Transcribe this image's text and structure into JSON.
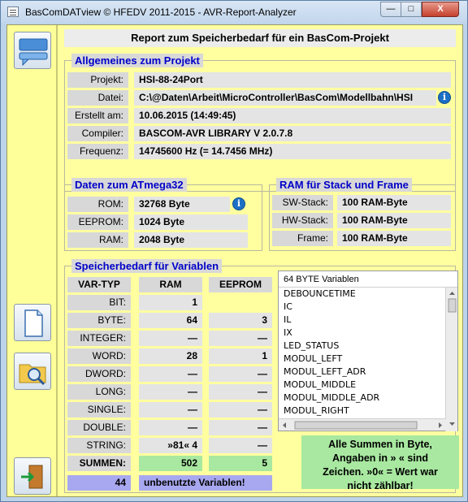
{
  "window": {
    "title": "BasComDATview © HFEDV 2011-2015 - AVR-Report-Analyzer",
    "minimize_glyph": "—",
    "maximize_glyph": "□",
    "close_glyph": "X"
  },
  "report": {
    "title": "Report zum Speicherbedarf für ein BasCom-Projekt"
  },
  "general": {
    "title": "Allgemeines zum Projekt",
    "rows": [
      {
        "label": "Projekt:",
        "value": "HSI-88-24Port"
      },
      {
        "label": "Datei:",
        "value": "C:\\@Daten\\Arbeit\\MicroController\\BasCom\\Modellbahn\\HSI"
      },
      {
        "label": "Erstellt am:",
        "value": "10.06.2015 (14:49:45)"
      },
      {
        "label": "Compiler:",
        "value": "BASCOM-AVR LIBRARY V 2.0.7.8"
      },
      {
        "label": "Frequenz:",
        "value": "14745600 Hz (= 14.7456 MHz)"
      }
    ]
  },
  "atmega": {
    "title": "Daten zum ATmega32",
    "rows": [
      {
        "label": "ROM:",
        "value": "32768 Byte"
      },
      {
        "label": "EEPROM:",
        "value": "1024 Byte"
      },
      {
        "label": "RAM:",
        "value": "2048 Byte"
      }
    ]
  },
  "stack": {
    "title": "RAM für Stack und Frame",
    "rows": [
      {
        "label": "SW-Stack:",
        "value": "100 RAM-Byte"
      },
      {
        "label": "HW-Stack:",
        "value": "100 RAM-Byte"
      },
      {
        "label": "Frame:",
        "value": "100 RAM-Byte"
      }
    ]
  },
  "vars": {
    "title": "Speicherbedarf für Variablen",
    "col_type": "VAR-TYP",
    "col_ram": "RAM",
    "col_eeprom": "EEPROM",
    "rows": [
      {
        "type": "BIT:",
        "ram": "1",
        "eeprom": ""
      },
      {
        "type": "BYTE:",
        "ram": "64",
        "eeprom": "3"
      },
      {
        "type": "INTEGER:",
        "ram": "—",
        "eeprom": "—"
      },
      {
        "type": "WORD:",
        "ram": "28",
        "eeprom": "1"
      },
      {
        "type": "DWORD:",
        "ram": "—",
        "eeprom": "—"
      },
      {
        "type": "LONG:",
        "ram": "—",
        "eeprom": "—"
      },
      {
        "type": "SINGLE:",
        "ram": "—",
        "eeprom": "—"
      },
      {
        "type": "DOUBLE:",
        "ram": "—",
        "eeprom": "—"
      },
      {
        "type": "STRING:",
        "ram": "»81« 4",
        "eeprom": "—"
      }
    ],
    "sum_label": "SUMMEN:",
    "sum_ram": "502",
    "sum_eeprom": "5",
    "unused_count": "44",
    "unused_label": "unbenutzte Variablen!"
  },
  "listbox": {
    "header": "64 BYTE Variablen",
    "items": [
      "DEBOUNCETIME",
      "IC",
      "IL",
      "IX",
      "LED_STATUS",
      "MODUL_LEFT",
      "MODUL_LEFT_ADR",
      "MODUL_MIDDLE",
      "MODUL_MIDDLE_ADR",
      "MODUL_RIGHT"
    ]
  },
  "note": {
    "line1": "Alle Summen in Byte,",
    "line2": "Angaben in » « sind",
    "line3": "Zeichen. »0« = Wert war",
    "line4": "nicht zählbar!"
  },
  "info_glyph": "i",
  "icons": [
    "app-icon",
    "comment-icon",
    "document-icon",
    "folder-search-icon",
    "exit-door-icon",
    "info-icon"
  ],
  "colors": {
    "background": "#ffff99",
    "group_title": "#0000c8",
    "sum_highlight": "#a8e8a0",
    "unused_highlight": "#a8a8f0",
    "info": "#1c6fc4"
  }
}
